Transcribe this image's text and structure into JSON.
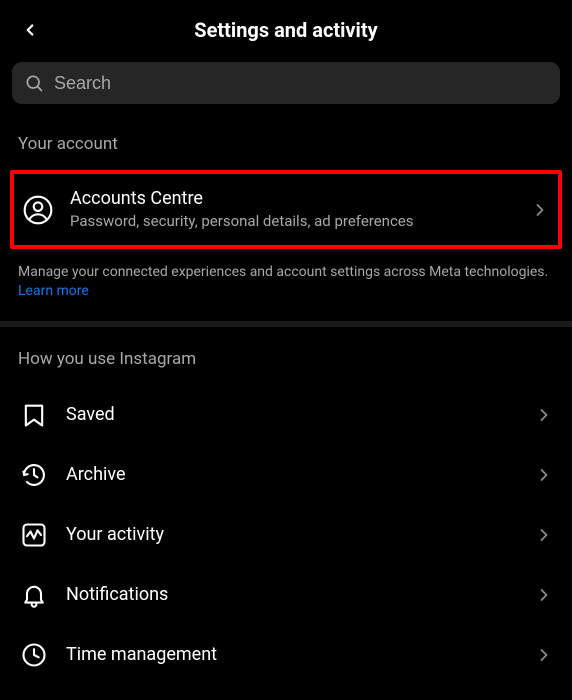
{
  "header": {
    "title": "Settings and activity"
  },
  "search": {
    "placeholder": "Search",
    "value": ""
  },
  "account_section": {
    "label": "Your account",
    "item": {
      "title": "Accounts Centre",
      "subtitle": "Password, security, personal details, ad preferences"
    },
    "blurb_prefix": "Manage your connected experiences and account settings across Meta technologies. ",
    "learn_more": "Learn more"
  },
  "usage_section": {
    "label": "How you use Instagram",
    "items": [
      {
        "key": "saved",
        "label": "Saved"
      },
      {
        "key": "archive",
        "label": "Archive"
      },
      {
        "key": "activity",
        "label": "Your activity"
      },
      {
        "key": "notifications",
        "label": "Notifications"
      },
      {
        "key": "time",
        "label": "Time management"
      }
    ]
  }
}
